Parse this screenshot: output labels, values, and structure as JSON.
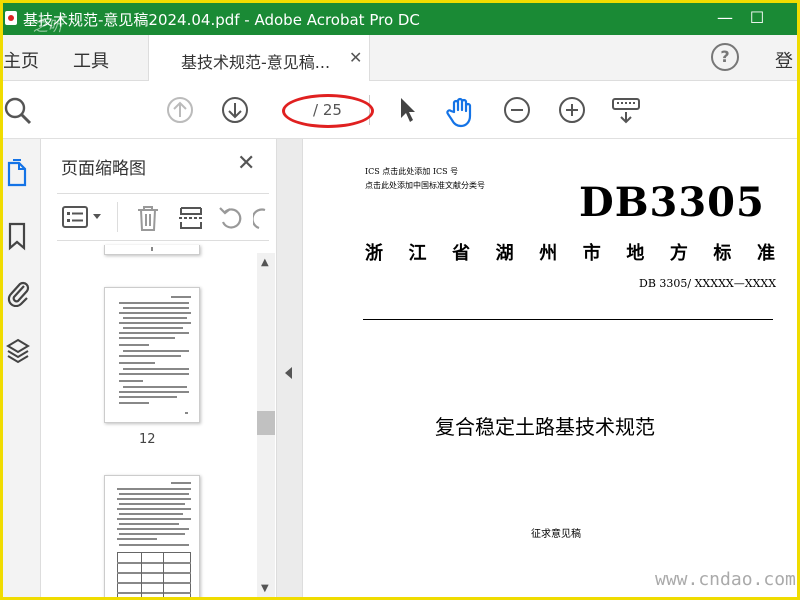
{
  "window": {
    "title": "基技术规范-意见稿2024.04.pdf - Adobe Acrobat Pro DC",
    "minimize": "—",
    "maximize": "☐",
    "watermark_top": "之听"
  },
  "tabs": {
    "home": "主页",
    "tools": "工具",
    "document_tab": "基技术规范-意见稿...",
    "close_glyph": "✕",
    "help_glyph": "?",
    "sign_in": "登"
  },
  "toolbar": {
    "page_current": "",
    "page_total": "/ 25"
  },
  "thumbnail_panel": {
    "title": "页面缩略图",
    "close_glyph": "✕",
    "page_label": "12",
    "scroll_up": "▲",
    "scroll_down": "▼"
  },
  "document": {
    "ics_line1": "ICS  点击此处添加 ICS 号",
    "ics_line2": "点击此处添加中国标准文献分类号",
    "db_code": "DB3305",
    "standard_name": "浙 江 省 湖 州 市 地 方 标 准",
    "standard_number": "DB 3305/  XXXXX—XXXX",
    "title": "复合稳定土路基技术规范",
    "draft_note": "征求意见稿",
    "watermark": "www.cndao.com"
  },
  "colors": {
    "titlebar": "#1a8a35",
    "accent_blue": "#1473e6",
    "annotation_red": "#e02020",
    "frame_yellow": "#f0dc00"
  }
}
